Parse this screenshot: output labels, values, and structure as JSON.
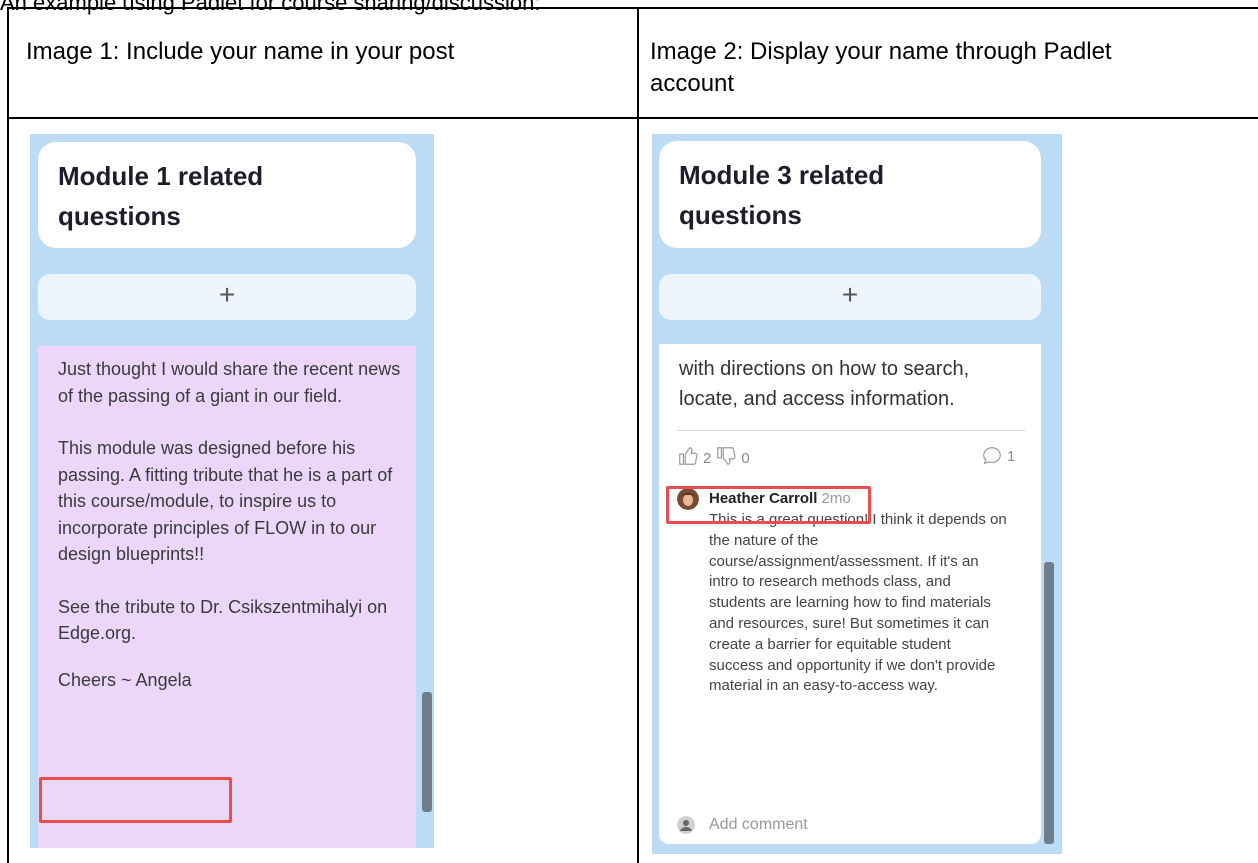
{
  "caption": "An example using Padlet for course sharing/discussion:",
  "table": {
    "col1_header": "Image 1: Include your name in your post",
    "col2_header_line1": "Image 2: Display your name through Padlet",
    "col2_header_line2": "account"
  },
  "image1": {
    "title_line1": "Module 1 related",
    "title_line2": "questions",
    "add_symbol": "+",
    "post_paragraphs": [
      "Just thought I would share the recent news of the passing of a giant in our field.",
      "This module was designed before his passing. A fitting tribute that he is a part of this course/module, to inspire us to incorporate principles of FLOW in to our design blueprints!!",
      "See the tribute to Dr. Csikszentmihalyi on Edge.org."
    ],
    "signature": "Cheers ~ Angela"
  },
  "image2": {
    "title_line1": "Module 3 related",
    "title_line2": "questions",
    "add_symbol": "+",
    "body_text": "with directions on how to search, locate, and access information.",
    "likes": "2",
    "dislikes": "0",
    "comments_count": "1",
    "commenter_name": "Heather Carroll",
    "comment_time": "2mo",
    "comment_text": "This is a great question! I think it depends on the nature of the course/assignment/assessment. If it's an intro to research methods class, and students are learning how to find materials and resources, sure! But sometimes it can create a barrier for equitable student success and opportunity if we don't provide material in an easy-to-access way.",
    "add_comment": "Add comment"
  },
  "colors": {
    "board_bg": "#bcdcf5",
    "post_bg": "#ecd7fa",
    "highlight": "#e84e4e",
    "scrollbar": "#6e7e8c"
  }
}
